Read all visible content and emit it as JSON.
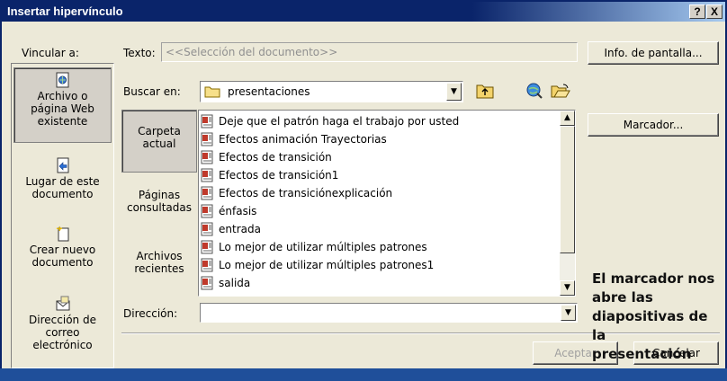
{
  "window": {
    "title": "Insertar hipervínculo",
    "help_button": "?",
    "close_button": "X"
  },
  "link_to": {
    "label": "Vincular a:",
    "items": [
      {
        "line1": "Archivo o",
        "line2": "página Web",
        "line3": "existente",
        "icon": "web-page-icon"
      },
      {
        "line1": "Lugar de este",
        "line2": "documento",
        "icon": "place-in-document-icon"
      },
      {
        "line1": "Crear nuevo",
        "line2": "documento",
        "icon": "new-document-icon"
      },
      {
        "line1": "Dirección de",
        "line2": "correo",
        "line3": "electrónico",
        "icon": "email-icon"
      }
    ]
  },
  "text_field": {
    "label": "Texto:",
    "value": "<<Selección del documento>>"
  },
  "screentip_button": "Info. de pantalla...",
  "look_in": {
    "label": "Buscar en:",
    "value": "presentaciones",
    "icons": [
      "up-folder-icon",
      "browse-web-icon",
      "browse-file-icon"
    ]
  },
  "sources": [
    {
      "line1": "Carpeta",
      "line2": "actual"
    },
    {
      "line1": "Páginas",
      "line2": "consultadas"
    },
    {
      "line1": "Archivos",
      "line2": "recientes"
    }
  ],
  "files": [
    "Deje que el patrón haga el trabajo por usted",
    "Efectos animación Trayectorias",
    "Efectos de transición",
    "Efectos de transición1",
    "Efectos de transiciónexplicación",
    "énfasis",
    "entrada",
    "Lo mejor de utilizar múltiples patrones",
    "Lo mejor de utilizar múltiples patrones1",
    "salida"
  ],
  "bookmark_button": "Marcador...",
  "address": {
    "label": "Dirección:",
    "value": ""
  },
  "ok_button": "Aceptar",
  "cancel_button": "Cancelar",
  "annotation": {
    "line1": "El marcador nos",
    "line2": "abre las",
    "line3": "diapositivas de la",
    "line4": "presentación"
  },
  "colors": {
    "title_bar": "#0a246a",
    "dialog_bg": "#ece9d8",
    "file_icon": "#c0392b"
  }
}
